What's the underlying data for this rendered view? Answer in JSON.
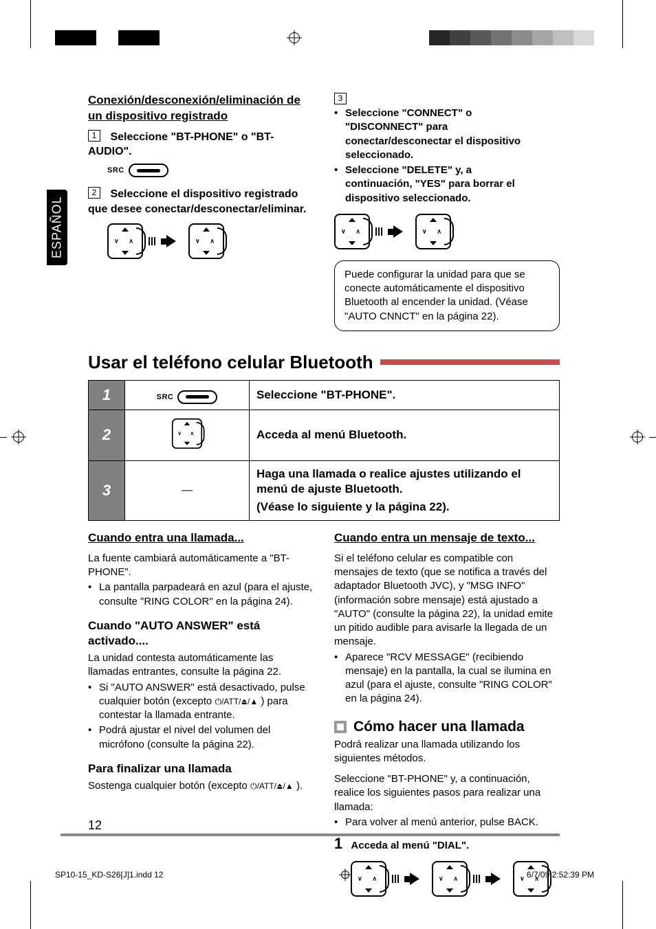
{
  "language_tab": "ESPAÑOL",
  "top_section": {
    "title": "Conexión/desconexión/eliminación de un dispositivo registrado",
    "step1": "Seleccione \"BT-PHONE\" o \"BT-AUDIO\".",
    "src_label": "SRC",
    "step2": "Seleccione el dispositivo registrado que desee conectar/desconectar/eliminar.",
    "step3_bullets": [
      "Seleccione \"CONNECT\" o \"DISCONNECT\" para conectar/desconectar el dispositivo seleccionado.",
      "Seleccione \"DELETE\" y, a continuación, \"YES\" para borrar el dispositivo seleccionado."
    ],
    "note": "Puede configurar la unidad para que se conecte automáticamente el dispositivo Bluetooth al encender la unidad. (Véase \"AUTO CNNCT\" en la página 22)."
  },
  "section_heading": "Usar el teléfono celular Bluetooth",
  "table": {
    "rows": [
      {
        "num": "1",
        "text": "Seleccione \"BT-PHONE\".",
        "icon": "src"
      },
      {
        "num": "2",
        "text": "Acceda al menú Bluetooth.",
        "icon": "dial"
      },
      {
        "num": "3",
        "text": "Haga una llamada o realice ajustes utilizando el menú de ajuste Bluetooth.",
        "sub": "(Véase lo siguiente y la página 22).",
        "icon": "dash"
      }
    ]
  },
  "left_lower": {
    "h_incoming": "Cuando entra una llamada...",
    "p1": "La fuente cambiará automáticamente a \"BT-PHONE\".",
    "b1": "La pantalla parpadeará en azul (para el ajuste, consulte \"RING COLOR\" en la página 24).",
    "h_auto": "Cuando \"AUTO ANSWER\" está activado....",
    "p2": "La unidad contesta automáticamente las llamadas entrantes, consulte la página 22.",
    "b2a_pre": "Si \"AUTO ANSWER\" está desactivado, pulse cualquier botón (excepto ",
    "b2a_post": ") para contestar la llamada entrante.",
    "b2b": "Podrá ajustar el nivel del volumen del micrófono (consulte la página 22).",
    "h_end": "Para finalizar una llamada",
    "p3_pre": "Sostenga cualquier botón (excepto ",
    "p3_post": ").",
    "att_label": "/ATT/"
  },
  "right_lower": {
    "h_msg": "Cuando entra un mensaje de texto...",
    "p1": "Si el teléfono celular es compatible con mensajes de texto (que se notifica a través del adaptador Bluetooth JVC), y \"MSG INFO\" (información sobre mensaje) está ajustado a \"AUTO\" (consulte la página 22), la unidad emite un pitido audible para avisarle la llegada de un mensaje.",
    "b1": "Aparece \"RCV MESSAGE\" (recibiendo mensaje) en la pantalla, la cual se ilumina en azul (para el ajuste, consulte \"RING COLOR\" en la página 24).",
    "h_call": "Cómo hacer una llamada",
    "p2": "Podrá realizar una llamada utilizando los siguientes métodos.",
    "p3": "Seleccione \"BT-PHONE\" y, a continuación, realice los siguientes pasos para realizar una llamada:",
    "b2": "Para volver al menú anterior, pulse BACK.",
    "step1_num": "1",
    "step1_text": "Acceda al menú \"DIAL\"."
  },
  "page_number": "12",
  "footer": {
    "file": "SP10-15_KD-S26[J]1.indd   12",
    "date": "6/7/09   2:52:39 PM"
  },
  "colors": {
    "swatch_row": [
      "#000000",
      "#000000",
      "",
      "#000000",
      "#000000",
      "",
      "",
      "#262626",
      "#404040",
      "#595959",
      "#737373",
      "#8c8c8c",
      "#a6a6a6",
      "#bfbfbf",
      "#d9d9d9"
    ]
  }
}
